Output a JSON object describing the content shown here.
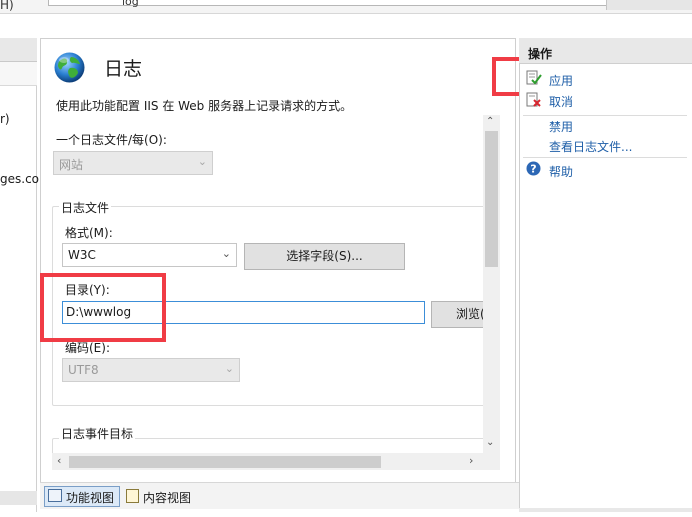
{
  "topbar": {
    "h_fragment": "H)",
    "address_fragment": "log"
  },
  "left_pane": {
    "items": [
      "r)",
      "ges.co"
    ]
  },
  "feature": {
    "title": "日志",
    "description": "使用此功能配置 IIS 在 Web 服务器上记录请求的方式。",
    "one_log_per_label": "一个日志文件/每(O):",
    "one_log_per_value": "网站",
    "log_file_group": "日志文件",
    "format_label": "格式(M):",
    "format_value": "W3C",
    "select_fields_button": "选择字段(S)...",
    "directory_label": "目录(Y):",
    "directory_value": "D:\\wwwlog",
    "browse_button": "浏览(",
    "encoding_label": "编码(E):",
    "encoding_value": "UTF8",
    "event_destination_group": "日志事件目标"
  },
  "view_tabs": {
    "feature_view": "功能视图",
    "content_view": "内容视图"
  },
  "actions": {
    "title": "操作",
    "apply": "应用",
    "cancel": "取消",
    "disable": "禁用",
    "view_log_files": "查看日志文件...",
    "help": "帮助"
  },
  "colors": {
    "annotation_red": "#f03c45",
    "link_blue": "#1f5fa8",
    "focus_blue": "#3c8ed8"
  },
  "icons": [
    "globe-icon",
    "apply-check-icon",
    "cancel-x-icon",
    "help-icon",
    "feature-view-icon",
    "content-view-icon",
    "chevron-down-icon"
  ]
}
